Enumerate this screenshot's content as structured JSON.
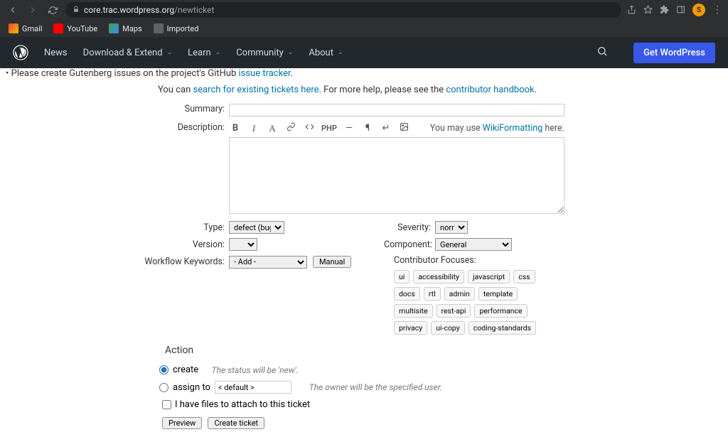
{
  "browser": {
    "url_host": "core.trac.wordpress.org",
    "url_path": "/newticket",
    "avatar_initial": "S"
  },
  "bookmarks": [
    {
      "label": "Gmail",
      "color": "#ea4335"
    },
    {
      "label": "YouTube",
      "color": "#ff0000"
    },
    {
      "label": "Maps",
      "color": "#34a853"
    },
    {
      "label": "Imported",
      "color": "#9aa0a6"
    }
  ],
  "nav": {
    "items": [
      "News",
      "Download & Extend",
      "Learn",
      "Community",
      "About"
    ],
    "cta": "Get WordPress"
  },
  "notes": {
    "gutenberg_pre": "Please create Gutenberg issues on the project's GitHub ",
    "gutenberg_link": "issue tracker",
    "intro_pre": "You can ",
    "intro_link1": "search for existing tickets here",
    "intro_mid": ". For more help, please see the ",
    "intro_link2": "contributor handbook",
    "intro_post": "."
  },
  "form": {
    "summary_label": "Summary:",
    "description_label": "Description:",
    "wiki_hint_pre": "You may use ",
    "wiki_hint_link": "WikiFormatting",
    "wiki_hint_post": " here.",
    "type_label": "Type:",
    "type_value": "defect (bug)",
    "version_label": "Version:",
    "workflow_label": "Workflow Keywords:",
    "workflow_value": "- Add -",
    "manual_btn": "Manual",
    "severity_label": "Severity:",
    "severity_value": "normal",
    "component_label": "Component:",
    "component_value": "General",
    "focus_label": "Contributor Focuses:",
    "focuses": [
      "ui",
      "accessibility",
      "javascript",
      "css",
      "docs",
      "rtl",
      "admin",
      "template",
      "multisite",
      "rest-api",
      "performance",
      "privacy",
      "ui-copy",
      "coding-standards"
    ]
  },
  "action": {
    "heading": "Action",
    "create_label": "create",
    "create_hint": "The status will be 'new'.",
    "assign_label": "assign to",
    "assign_value": "< default >",
    "assign_hint": "The owner will be the specified user.",
    "attach_label": "I have files to attach to this ticket",
    "preview_btn": "Preview",
    "submit_btn": "Create ticket"
  }
}
